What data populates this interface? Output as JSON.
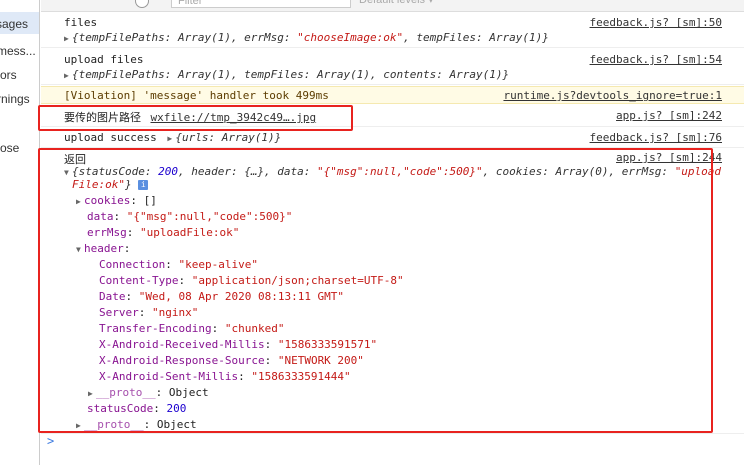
{
  "sidebar": {
    "items": [
      "sages",
      "mess...",
      "ors",
      "rnings",
      "ose"
    ]
  },
  "toolbar": {
    "filter_placeholder": "Filter",
    "levels_label": "Default levels ▾"
  },
  "messages": [
    {
      "label": "files",
      "detail_prefix": "{tempFilePaths: Array(1), errMsg: ",
      "detail_str": "\"chooseImage:ok\"",
      "detail_suffix": ", tempFiles: Array(1)}",
      "source": "feedback.js? [sm]:50"
    },
    {
      "label": "upload files",
      "detail": "{tempFilePaths: Array(1), tempFiles: Array(1), contents: Array(1)}",
      "source": "feedback.js? [sm]:54"
    },
    {
      "label": "[Violation] 'message' handler took 499ms",
      "source": "runtime.js?devtools_ignore=true:1"
    },
    {
      "label": "要传的图片路径",
      "link": "wxfile://tmp_3942c49….jpg",
      "source": "app.js? [sm]:242"
    },
    {
      "label": "upload success",
      "detail": "{urls: Array(1)}",
      "source": "feedback.js? [sm]:76"
    },
    {
      "label": "返回",
      "source": "app.js? [sm]:244"
    }
  ],
  "response": {
    "summary_a": "{statusCode: ",
    "summary_status": "200",
    "summary_b": ", header: {…}, data: ",
    "summary_data": "\"{\"msg\":null,\"code\":500}\"",
    "summary_c": ", cookies: Array(0), errMsg: ",
    "summary_errmsg_1": "\"upload",
    "summary_errmsg_2": "File:ok\"",
    "summary_d": "}",
    "cookies_key": "cookies",
    "cookies_val": "[]",
    "data_key": "data",
    "data_val": "\"{\"msg\":null,\"code\":500}\"",
    "errmsg_key": "errMsg",
    "errmsg_val": "\"uploadFile:ok\"",
    "header_key": "header",
    "headers": [
      {
        "k": "Connection",
        "v": "\"keep-alive\""
      },
      {
        "k": "Content-Type",
        "v": "\"application/json;charset=UTF-8\""
      },
      {
        "k": "Date",
        "v": "\"Wed, 08 Apr 2020 08:13:11 GMT\""
      },
      {
        "k": "Server",
        "v": "\"nginx\""
      },
      {
        "k": "Transfer-Encoding",
        "v": "\"chunked\""
      },
      {
        "k": "X-Android-Received-Millis",
        "v": "\"1586333591571\""
      },
      {
        "k": "X-Android-Response-Source",
        "v": "\"NETWORK 200\""
      },
      {
        "k": "X-Android-Sent-Millis",
        "v": "\"1586333591444\""
      }
    ],
    "proto_key": "__proto__",
    "proto_val": "Object",
    "status_key": "statusCode",
    "status_val": "200"
  },
  "prompt_symbol": ">",
  "colors": {
    "highlight": "#e8231f",
    "violation_bg": "#fffbe5"
  }
}
